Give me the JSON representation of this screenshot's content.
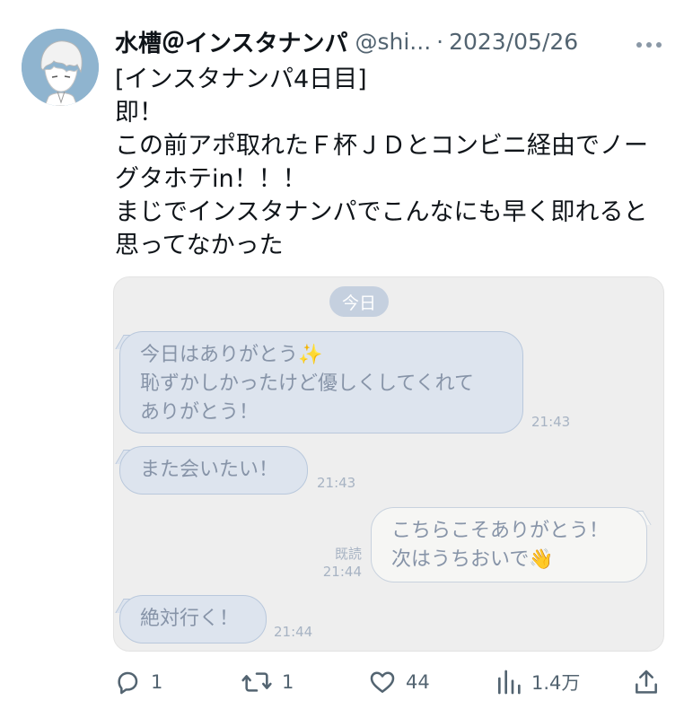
{
  "tweet": {
    "display_name": "水槽＠インスタナンパ",
    "handle": "@shi...",
    "separator": "·",
    "date": "2023/05/26",
    "more_icon": "more-horizontal-icon",
    "text_lines": [
      "[インスタナンパ4日目]",
      "即！",
      "この前アポ取れたＦ杯ＪＤとコンビニ経由でノー",
      "グタホテin！！！",
      "まじでインスタナンパでこんなにも早く即れると",
      "思ってなかった"
    ]
  },
  "chat": {
    "date_chip": "今日",
    "messages": [
      {
        "side": "in",
        "lines": [
          "今日はありがとう✨",
          "恥ずかしかったけど優しくしてくれて",
          "ありがとう！"
        ],
        "time": "21:43"
      },
      {
        "side": "in",
        "lines": [
          "また会いたい！"
        ],
        "time": "21:43"
      },
      {
        "side": "out",
        "lines": [
          "こちらこそありがとう！",
          "次はうちおいで👋"
        ],
        "read": "既読",
        "time": "21:44"
      },
      {
        "side": "in",
        "lines": [
          "絶対行く！"
        ],
        "time": "21:44"
      }
    ]
  },
  "actions": {
    "reply": {
      "icon": "reply-icon",
      "count": "1"
    },
    "retweet": {
      "icon": "retweet-icon",
      "count": "1"
    },
    "like": {
      "icon": "heart-icon",
      "count": "44"
    },
    "views": {
      "icon": "views-chart-icon",
      "count": "1.4万"
    },
    "share": {
      "icon": "share-icon"
    }
  },
  "colors": {
    "secondary_text": "#536471",
    "incoming_bubble": "#dde4ee",
    "outgoing_bubble": "#f6f6f4",
    "chat_background": "#eeeeee",
    "date_chip": "#c5d0df"
  }
}
